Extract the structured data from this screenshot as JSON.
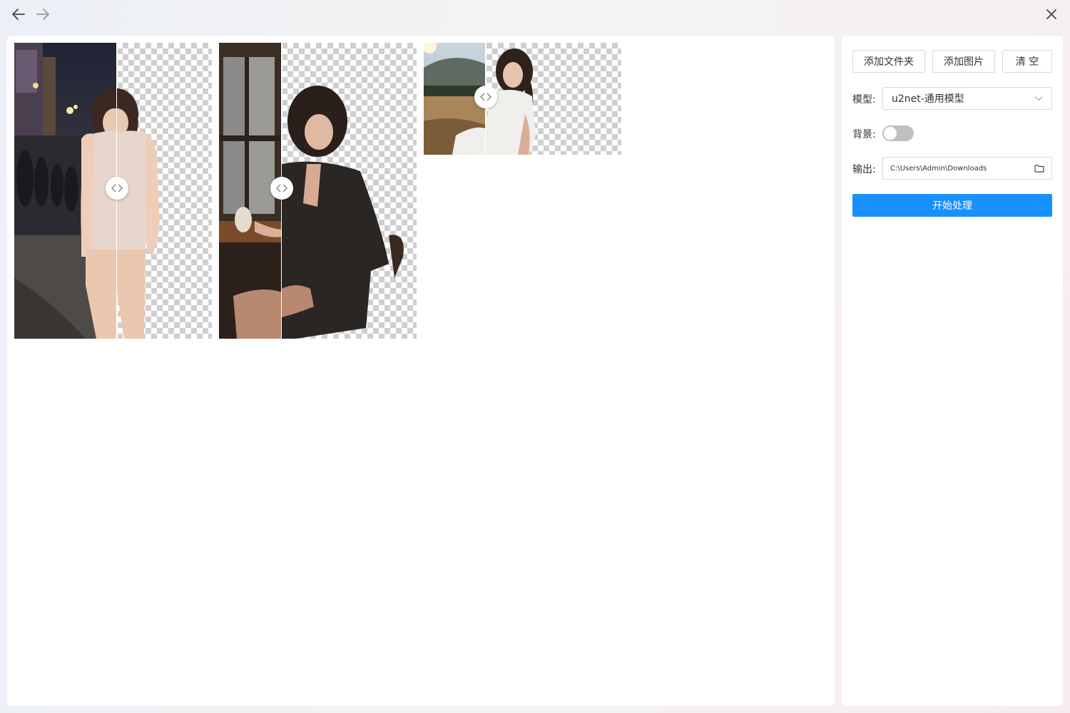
{
  "toolbar": {
    "back_icon": "arrow-left-icon",
    "forward_icon": "arrow-right-icon",
    "close_icon": "close-icon"
  },
  "sidebar": {
    "add_folder_label": "添加文件夹",
    "add_image_label": "添加图片",
    "clear_label": "清 空",
    "model_label": "模型:",
    "model_value": "u2net-通用模型",
    "background_label": "背景:",
    "background_enabled": false,
    "output_label": "输出:",
    "output_path": "C:\\Users\\Admin\\Downloads",
    "start_label": "开始处理"
  },
  "colors": {
    "accent": "#1890ff",
    "toggle_off": "#bfbfbf",
    "border": "#d9d9d9"
  },
  "images": [
    {
      "name": "result-1",
      "split_ratio": 0.52,
      "scene": "street-night"
    },
    {
      "name": "result-2",
      "split_ratio": 0.32,
      "scene": "cafe-window"
    },
    {
      "name": "result-3",
      "split_ratio": 0.31,
      "scene": "wheat-field"
    }
  ]
}
